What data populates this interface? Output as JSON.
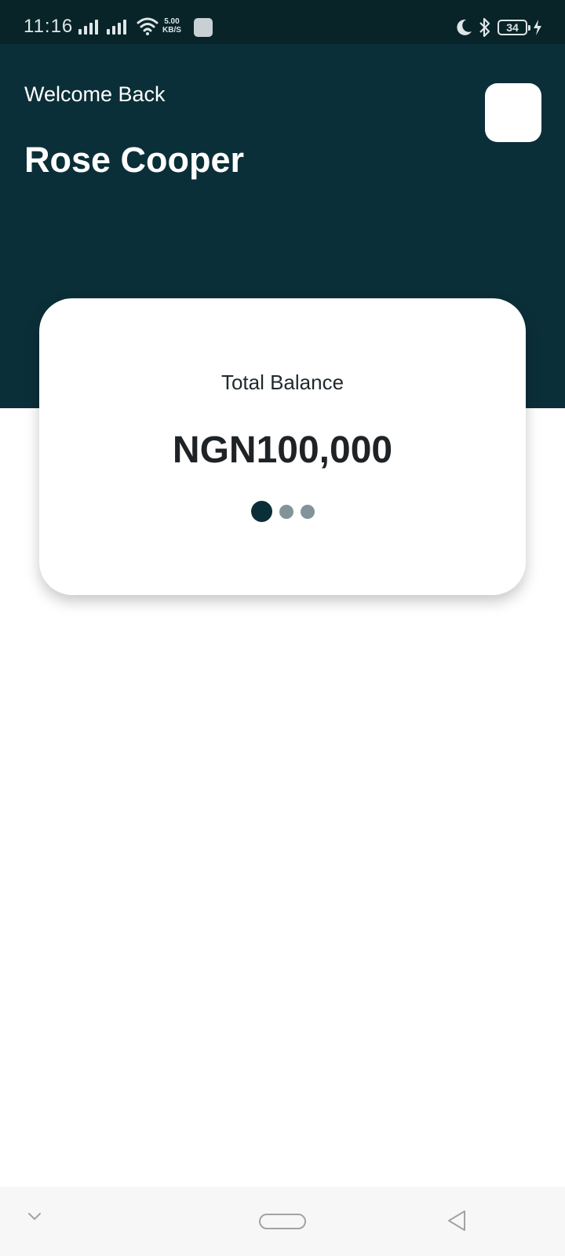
{
  "status_bar": {
    "time": "11:16",
    "network_speed": "5.00",
    "network_speed_unit": "KB/S",
    "battery_level": "34",
    "icons": [
      "signal-icon",
      "signal-icon",
      "wifi-icon",
      "app-notification-icon",
      "moon-icon",
      "bluetooth-icon",
      "battery-icon",
      "charging-icon"
    ]
  },
  "header": {
    "greeting": "Welcome Back",
    "user_name": "Rose Cooper",
    "background_color": "#0b2f38"
  },
  "balance_card": {
    "label": "Total Balance",
    "amount": "NGN100,000",
    "pager": {
      "total_pages": 3,
      "active_page": 1
    }
  },
  "nav_bar": {
    "icons": [
      "chevron-down-icon",
      "home-pill-icon",
      "back-triangle-icon"
    ]
  }
}
